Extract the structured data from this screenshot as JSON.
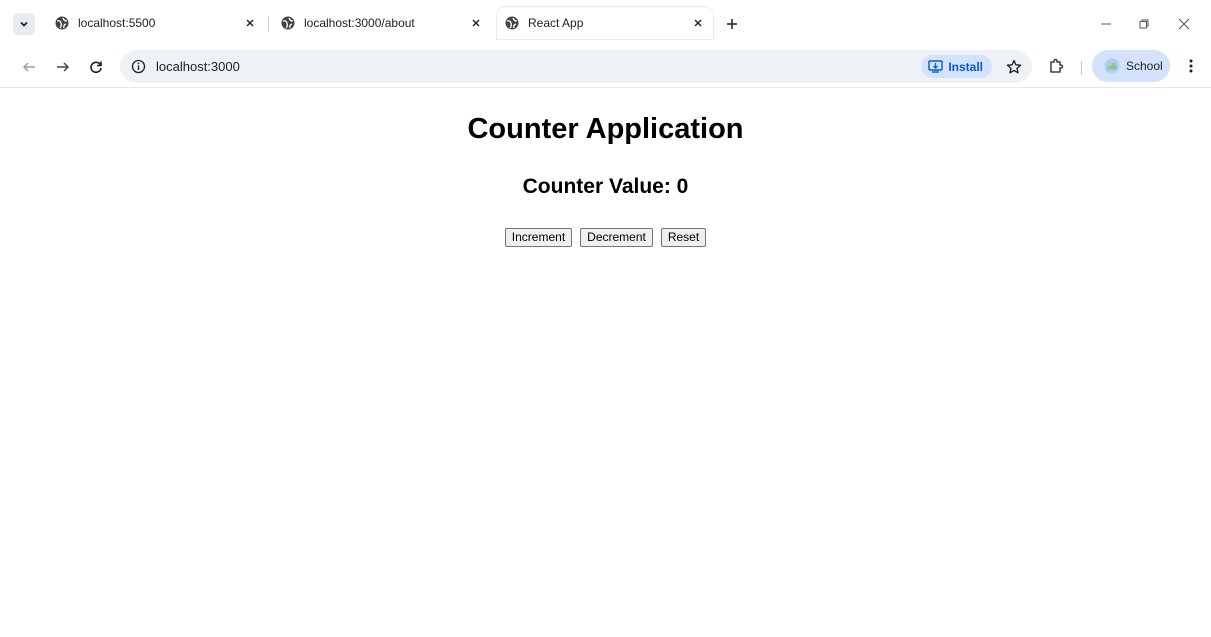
{
  "browser": {
    "tabs": [
      {
        "title": "localhost:5500",
        "active": false
      },
      {
        "title": "localhost:3000/about",
        "active": false
      },
      {
        "title": "React App",
        "active": true
      }
    ],
    "url": "localhost:3000",
    "install_label": "Install",
    "profile_label": "School"
  },
  "page": {
    "heading": "Counter Application",
    "counter_label": "Counter Value: 0",
    "buttons": {
      "increment": "Increment",
      "decrement": "Decrement",
      "reset": "Reset"
    }
  },
  "colors": {
    "accent": "#0b57d0",
    "accent_bg": "#d3e3fd",
    "omnibox_bg": "#eef1f6"
  }
}
